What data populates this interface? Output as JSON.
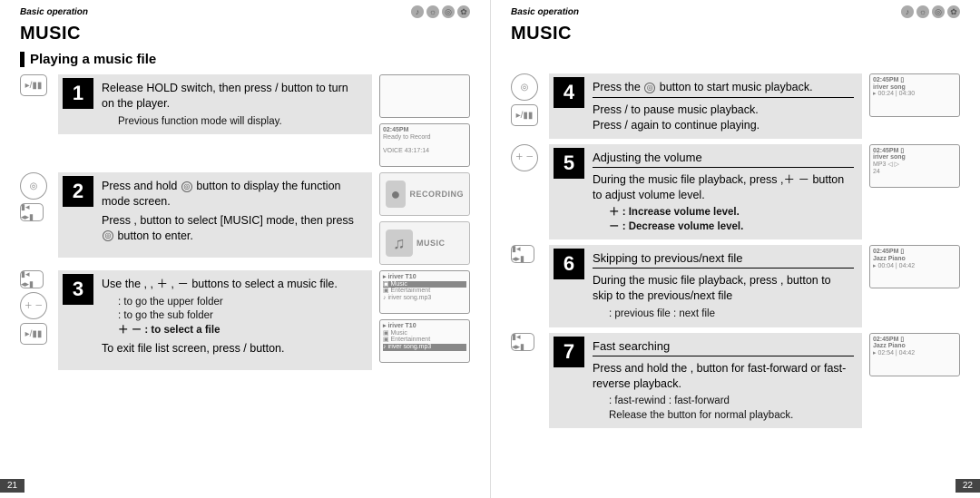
{
  "header_left": "Basic operation",
  "header_right": "Basic operation",
  "title": "MUSIC",
  "subtitle": "Playing a music file",
  "page_left_num": "21",
  "page_right_num": "22",
  "header_icons": [
    "♪",
    "☼",
    "◎",
    "✿"
  ],
  "buttons": {
    "play": "▸/▮▮",
    "navi": "◎",
    "skip": "▮◂ ◂▸▮",
    "vol": "＋ －"
  },
  "step1": {
    "num": "1",
    "line1a": "Release HOLD switch, then press ",
    "line1b": " / ",
    "line1c": " button to turn on the player.",
    "note": "Previous function mode will display."
  },
  "step2": {
    "num": "2",
    "line1a": "Press and hold ",
    "line1b": "button to display the function mode screen.",
    "line2": "Press       ,        button to select [MUSIC] mode, then press ",
    "line2b": "button to enter."
  },
  "step3": {
    "num": "3",
    "line1": "Use the        ,       , ＋ , － buttons to select a music file.",
    "sub1": " : to go the upper folder",
    "sub2": " : to go the sub folder",
    "sub3": "＋  － : to select a file",
    "line2": "To exit file list screen, press       /        button."
  },
  "step4": {
    "num": "4",
    "line1a": "Press the ",
    "line1b": " button to start music playback.",
    "line2": "Press       /        to pause music playback.",
    "line3": "Press       /        again to continue playing."
  },
  "step5": {
    "num": "5",
    "title": "Adjusting the volume",
    "line1": "During the music file playback, press      ,＋  － button to adjust volume level.",
    "sub1": "＋ : Increase volume level.",
    "sub2": "－ : Decrease volume level."
  },
  "step6": {
    "num": "6",
    "title": "Skipping to previous/next file",
    "line1": "During the music file playback, press           ,           button to skip to the previous/next file",
    "sub": "         : previous file              : next file"
  },
  "step7": {
    "num": "7",
    "title": "Fast searching",
    "line1": "Press and hold the           ,           button for fast-forward or fast-reverse playback.",
    "sub1": "         : fast-rewind              : fast-forward",
    "sub2": "Release the button for normal playback."
  },
  "screens": {
    "blank": "",
    "ready": {
      "l1": "02:45PM",
      "l2": "Ready to Record",
      "l3": "VOICE    43:17:14"
    },
    "rec_label": "RECORDING",
    "music_label": "MUSIC",
    "list1": {
      "l0": "▸ iriver T10",
      "l1": "▣ Music",
      "l2": "▣ Entertainment",
      "l3": "♪ iriver song.mp3"
    },
    "list2": {
      "l0": "▸ iriver T10",
      "l1": "▣ Music",
      "l2": "▣ Entertainment",
      "l3": "♪ iriver song.mp3"
    },
    "play1": {
      "l0": "02:45PM      ▯",
      "l1": "iriver song",
      "l2": "",
      "l3": "▸   00:24 | 04:30"
    },
    "play2": {
      "l0": "02:45PM      ▯",
      "l1": "iriver song",
      "l2": "MP3   ◁          ▷",
      "l3": "                    24"
    },
    "play3": {
      "l0": "02:45PM      ▯",
      "l1": "Jazz Piano",
      "l2": "",
      "l3": "▸   00:04 | 04:42"
    },
    "play4": {
      "l0": "02:45PM      ▯",
      "l1": "Jazz Piano",
      "l2": "",
      "l3": "▸   02:54 | 04:42"
    }
  }
}
